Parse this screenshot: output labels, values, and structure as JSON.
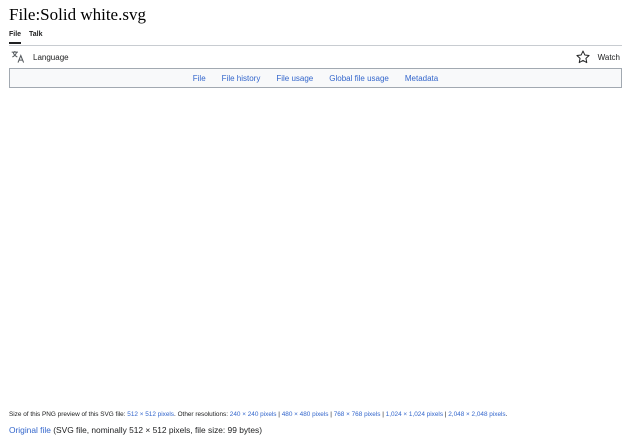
{
  "page": {
    "title": "File:Solid white.svg"
  },
  "namespace_tabs": [
    {
      "label": "File",
      "selected": true
    },
    {
      "label": "Talk",
      "selected": false
    }
  ],
  "toolbar": {
    "language_label": "Language",
    "language_icon": "translate-icon",
    "watch_label": "Watch",
    "watch_icon": "star-icon"
  },
  "filetoc": {
    "links": [
      "File",
      "File history",
      "File usage",
      "Global file usage",
      "Metadata"
    ]
  },
  "file_info": {
    "preview_prefix": "Size of this PNG preview of this SVG file: ",
    "preview_size": "512 × 512 pixels",
    "other_prefix": ". Other resolutions: ",
    "separator": " | ",
    "resolutions": [
      "240 × 240 pixels",
      "480 × 480 pixels",
      "768 × 768 pixels",
      "1,024 × 1,024 pixels",
      "2,048 × 2,048 pixels"
    ],
    "end_punct": ".",
    "original_link": "Original file",
    "original_desc": " (SVG file, nominally 512 × 512 pixels, file size: 99 bytes)"
  },
  "colors": {
    "link": "#3366cc",
    "text": "#202122",
    "border": "#a2a9b1",
    "toc_bg": "#f8f9fa"
  }
}
